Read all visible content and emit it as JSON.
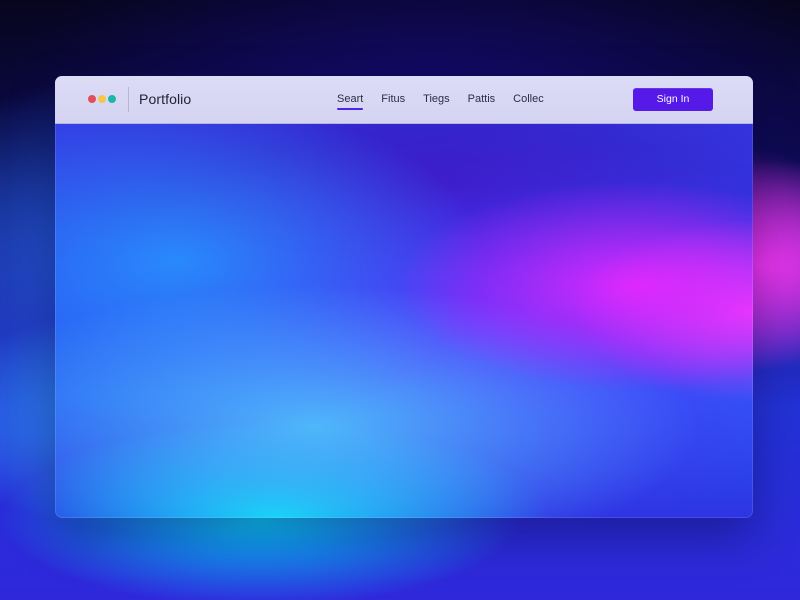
{
  "window": {
    "brand": "Portfolio"
  },
  "nav": {
    "items": [
      {
        "label": "Seart",
        "active": true
      },
      {
        "label": "Fitus",
        "active": false
      },
      {
        "label": "Tiegs",
        "active": false
      },
      {
        "label": "Pattis",
        "active": false
      },
      {
        "label": "Collec",
        "active": false
      }
    ]
  },
  "actions": {
    "sign_in": "Sign In"
  },
  "colors": {
    "accent": "#5519E8",
    "nav_active": "#4D23E8",
    "topbar": "#D8D8F4",
    "traffic_red": "#E34E5B",
    "traffic_yellow": "#F6C646",
    "traffic_green": "#1DB7A8",
    "gradient_magenta": "#EF2DFF",
    "gradient_cyan": "#00E2FF",
    "gradient_blue": "#2C39EB"
  },
  "icons": {
    "window_controls": [
      "red-dot-icon",
      "yellow-dot-icon",
      "green-dot-icon"
    ]
  }
}
